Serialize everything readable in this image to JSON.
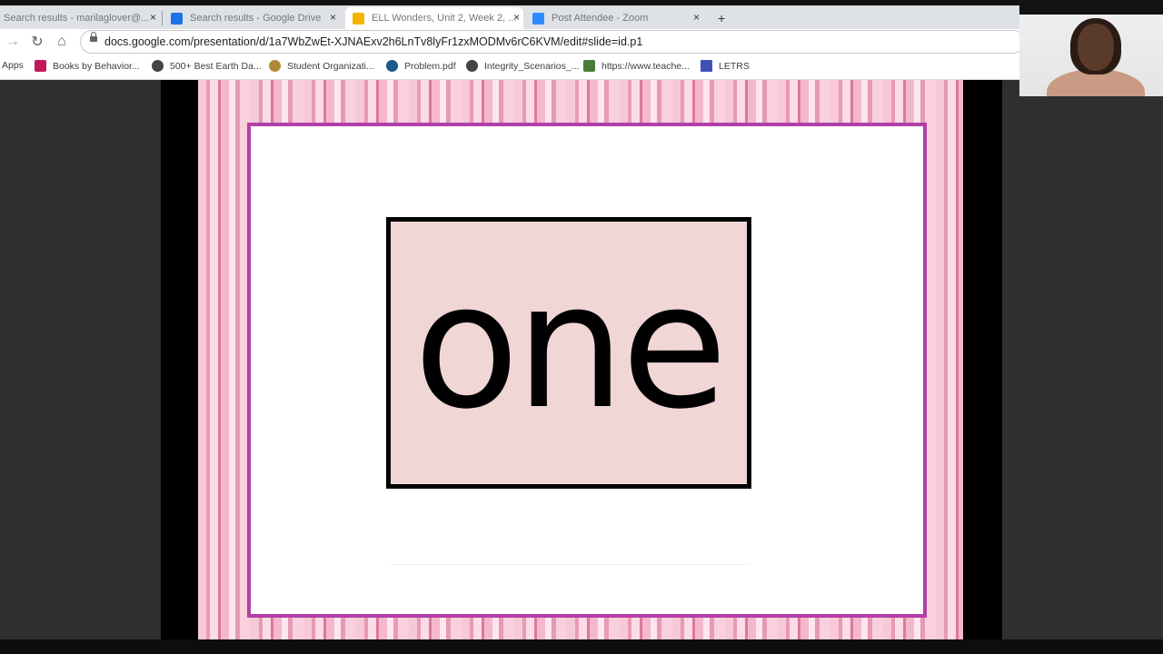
{
  "browser": {
    "tabs": [
      {
        "title": "Search results - marilaglover@...",
        "favicon_color": "#1a73e8"
      },
      {
        "title": "Search results - Google Drive",
        "favicon_color": "#1a73e8"
      },
      {
        "title": "ELL Wonders, Unit 2, Week 2, ...",
        "favicon_color": "#f4b400"
      },
      {
        "title": "Post Attendee - Zoom",
        "favicon_color": "#2d8cff"
      }
    ],
    "close_glyph": "×",
    "new_tab_glyph": "+",
    "url": "docs.google.com/presentation/d/1a7WbZwEt-XJNAExv2h6LnTv8lyFr1zxMODMv6rC6KVM/edit#slide=id.p1",
    "bookmarks": [
      {
        "label": "Apps"
      },
      {
        "label": "Books by Behavior..."
      },
      {
        "label": "500+ Best Earth Da..."
      },
      {
        "label": "Student Organizati..."
      },
      {
        "label": "Problem.pdf"
      },
      {
        "label": "Integrity_Scenarios_..."
      },
      {
        "label": "https://www.teache..."
      },
      {
        "label": "LETRS"
      }
    ]
  },
  "slide": {
    "word": "one",
    "colors": {
      "frame_border": "#b23fa8",
      "word_box_fill": "#f1d6d6",
      "stripe_pink": "#f7c9d6"
    }
  },
  "icons": {
    "forward": "→",
    "reload": "↻",
    "home": "⌂"
  }
}
